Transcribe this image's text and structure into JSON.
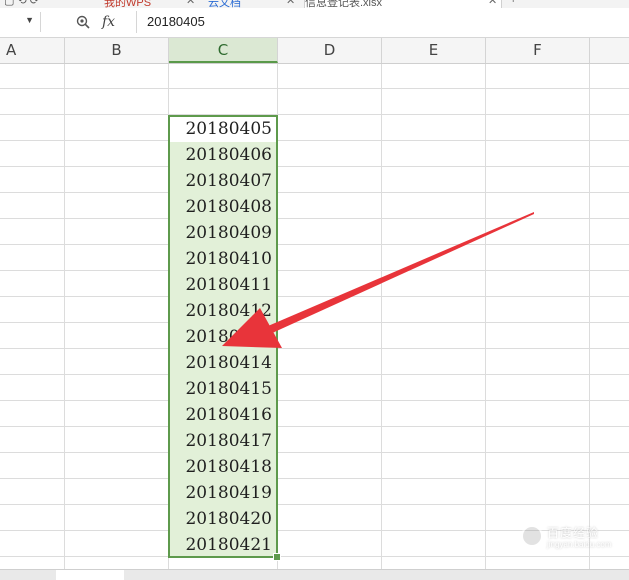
{
  "tabs": [
    {
      "label": "我的WPS"
    },
    {
      "label": "云文档"
    },
    {
      "label": "信息登记表.xlsx"
    }
  ],
  "formula_bar": {
    "fx_label": "fx",
    "value": "20180405"
  },
  "columns": [
    "A",
    "B",
    "C",
    "D",
    "E",
    "F"
  ],
  "selected_column": "C",
  "cells_c": [
    "20180405",
    "20180406",
    "20180407",
    "20180408",
    "20180409",
    "20180410",
    "20180411",
    "20180412",
    "20180413",
    "20180414",
    "20180415",
    "20180416",
    "20180417",
    "20180418",
    "20180419",
    "20180420",
    "20180421"
  ],
  "watermark": {
    "line1": "百度经验",
    "line2": "jingyan.baidu.com"
  },
  "colors": {
    "selection_border": "#5e9a4c",
    "selection_fill": "#e2f0d8",
    "arrow": "#e8343a"
  },
  "icons": [
    "zoom-icon",
    "fx-icon",
    "dropdown-arrow-icon",
    "close-icon",
    "arrow-annotation"
  ]
}
